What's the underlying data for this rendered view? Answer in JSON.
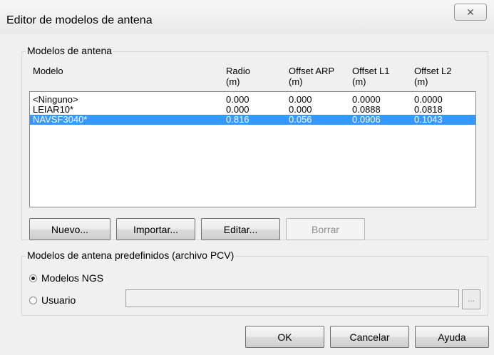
{
  "window": {
    "title": "Editor de modelos de antena",
    "close_glyph": "✕"
  },
  "models_group": {
    "legend": "Modelos de antena",
    "columns": [
      {
        "line1": "Modelo",
        "line2": ""
      },
      {
        "line1": "Radio",
        "line2": "(m)"
      },
      {
        "line1": "Offset ARP",
        "line2": "(m)"
      },
      {
        "line1": "Offset L1",
        "line2": "(m)"
      },
      {
        "line1": "Offset L2",
        "line2": "(m)"
      }
    ],
    "rows": [
      {
        "model": "<Ninguno>",
        "radio": "0.000",
        "arp": "0.000",
        "l1": "0.0000",
        "l2": "0.0000",
        "selected": false
      },
      {
        "model": "LEIAR10*",
        "radio": "0.000",
        "arp": "0.000",
        "l1": "0.0888",
        "l2": "0.0818",
        "selected": false
      },
      {
        "model": "NAVSF3040*",
        "radio": "0.816",
        "arp": "0.056",
        "l1": "0.0906",
        "l2": "0.1043",
        "selected": true
      }
    ],
    "buttons": {
      "nuevo": "Nuevo...",
      "importar": "Importar...",
      "editar": "Editar...",
      "borrar": "Borrar"
    }
  },
  "predef_group": {
    "legend": "Modelos de antena predefinidos (archivo PCV)",
    "option_ngs": "Modelos NGS",
    "option_usuario": "Usuario",
    "selected": "ngs",
    "user_path": "",
    "browse_label": "..."
  },
  "footer": {
    "ok": "OK",
    "cancel": "Cancelar",
    "help": "Ayuda"
  }
}
